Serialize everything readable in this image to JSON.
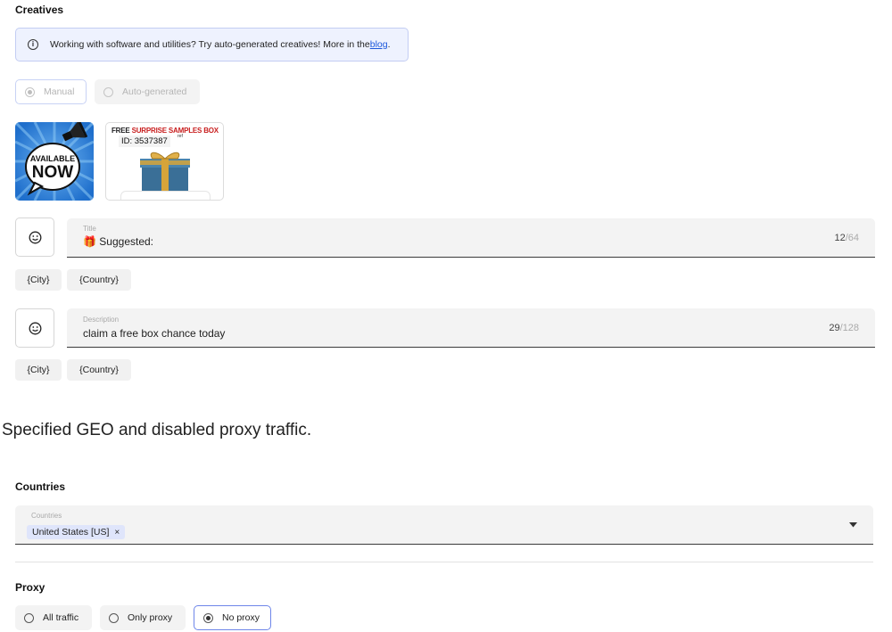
{
  "creatives": {
    "title": "Creatives",
    "info": {
      "text": "Working with software and utilities? Try auto-generated creatives! More in the ",
      "link_text": "blog",
      "suffix": "."
    },
    "mode_options": [
      {
        "label": "Manual",
        "selected": true
      },
      {
        "label": "Auto-generated",
        "selected": false
      }
    ],
    "images": [
      {
        "name": "available-now-banner",
        "text_line1": "AVAILABLE",
        "text_line2": "NOW",
        "bg_color": "#2f7fd6"
      },
      {
        "name": "free-surprise-samples-box",
        "free_text": "FREE",
        "headline": "SURPRISE SAMPLES BOX",
        "id_label": "ID: 3537387",
        "ref": "ref"
      }
    ],
    "title_field": {
      "label": "Title",
      "emoji": "🎁",
      "value": "Suggested:",
      "count": "12",
      "max": "/64"
    },
    "description_field": {
      "label": "Description",
      "value": "claim a free box chance today",
      "count": "29",
      "max": "/128"
    },
    "macros": [
      "{City}",
      "{Country}"
    ]
  },
  "note": "Specified GEO and disabled proxy traffic.",
  "countries": {
    "title": "Countries",
    "field_label": "Countries",
    "selected_tag": "United States [US]",
    "remove_symbol": "×"
  },
  "proxy": {
    "title": "Proxy",
    "options": [
      {
        "label": "All traffic",
        "selected": false
      },
      {
        "label": "Only proxy",
        "selected": false
      },
      {
        "label": "No proxy",
        "selected": true
      }
    ]
  },
  "colors": {
    "accent": "#6e86e9",
    "link": "#1a56db",
    "info_bg": "#eef2fe",
    "field_bg": "#f3f3f3"
  }
}
